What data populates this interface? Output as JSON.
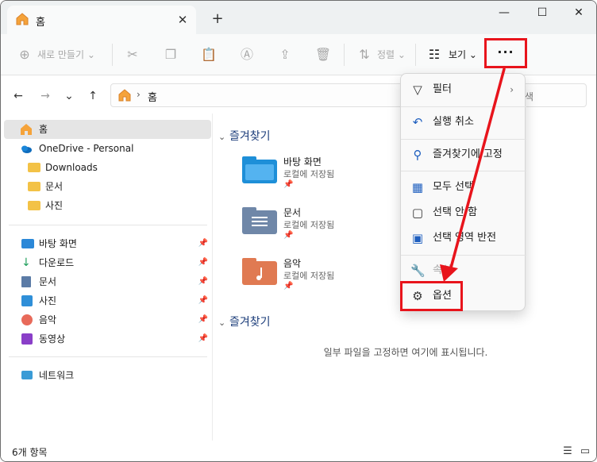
{
  "tab": {
    "title": "홈",
    "close": "✕",
    "new_tab": "+"
  },
  "window_controls": {
    "minimize": "—",
    "maximize": "☐",
    "close": "✕"
  },
  "toolbar": {
    "new_label": "새로 만들기",
    "sort_label": "정렬",
    "view_label": "보기",
    "more_label": "···"
  },
  "address": {
    "crumb": "홈",
    "search_placeholder": "색"
  },
  "sidebar": {
    "home": "홈",
    "onedrive": "OneDrive - Personal",
    "folders": [
      "Downloads",
      "문서",
      "사진"
    ],
    "quick": [
      "바탕 화면",
      "다운로드",
      "문서",
      "사진",
      "음악",
      "동영상"
    ],
    "network": "네트워크"
  },
  "main": {
    "favorites_heading": "즐겨찾기",
    "favorites": [
      {
        "title": "바탕 화면",
        "sub": "로컬에 저장됨"
      },
      {
        "title": "문서",
        "sub": "로컬에 저장됨"
      },
      {
        "title": "음악",
        "sub": "로컬에 저장됨"
      }
    ],
    "section2_heading": "즐겨찾기",
    "empty_message": "일부 파일을 고정하면 여기에 표시됩니다."
  },
  "status": {
    "count": "6개 항목"
  },
  "menu": {
    "items": [
      {
        "label": "필터",
        "icon": "filter-icon"
      },
      {
        "label": "실행 취소",
        "icon": "undo-icon"
      },
      {
        "label": "즐겨찾기에 고정",
        "icon": "pin-icon"
      },
      {
        "label": "모두 선택",
        "icon": "select-all-icon"
      },
      {
        "label": "선택 안 함",
        "icon": "select-none-icon"
      },
      {
        "label": "선택 영역 반전",
        "icon": "invert-selection-icon"
      },
      {
        "label": "속성",
        "icon": "properties-icon"
      },
      {
        "label": "옵션",
        "icon": "options-gear-icon"
      }
    ]
  },
  "colors": {
    "annotation": "#e8141c",
    "accent": "#1f5fbf"
  }
}
